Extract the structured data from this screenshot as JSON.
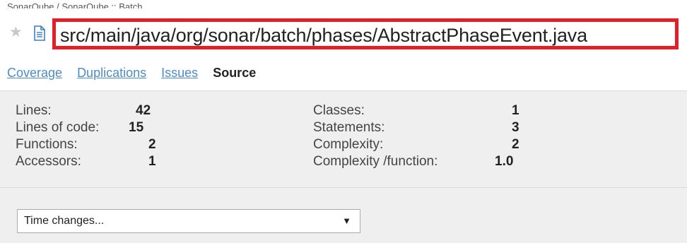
{
  "breadcrumb": "SonarQube / SonarQube :: Batch",
  "file": {
    "path": "src/main/java/org/sonar/batch/phases/AbstractPhaseEvent.java",
    "star_icon": "star-icon",
    "file_icon": "file-icon"
  },
  "tabs": [
    {
      "label": "Coverage",
      "active": false
    },
    {
      "label": "Duplications",
      "active": false
    },
    {
      "label": "Issues",
      "active": false
    },
    {
      "label": "Source",
      "active": true
    }
  ],
  "metrics": {
    "left": [
      {
        "label": "Lines:",
        "value": "42"
      },
      {
        "label": "Lines of code:",
        "value": "15"
      },
      {
        "label": "Functions:",
        "value": "2"
      },
      {
        "label": "Accessors:",
        "value": "1"
      }
    ],
    "right": [
      {
        "label": "Classes:",
        "value": "1"
      },
      {
        "label": "Statements:",
        "value": "3"
      },
      {
        "label": "Complexity:",
        "value": "2"
      },
      {
        "label": "Complexity /function:",
        "value": "1.0"
      }
    ]
  },
  "time_changes": {
    "selected": "Time changes...",
    "arrow_icon": "dropdown-arrow-icon"
  },
  "colors": {
    "highlight_border": "#e41e26",
    "link": "#4b8cc8",
    "panel_bg": "#efefef"
  }
}
